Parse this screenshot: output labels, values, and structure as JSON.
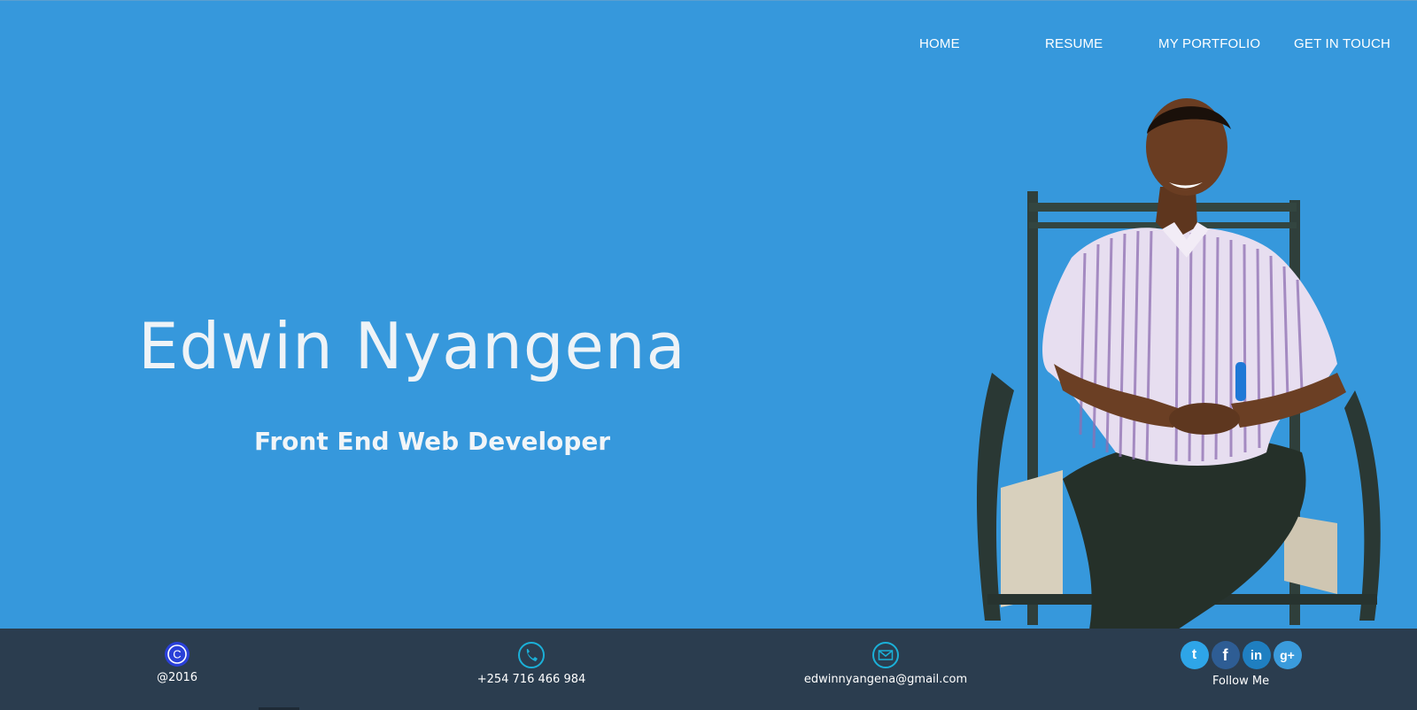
{
  "nav": {
    "items": [
      {
        "label": "HOME"
      },
      {
        "label": "RESUME"
      },
      {
        "label": "MY PORTFOLIO"
      },
      {
        "label": "GET IN TOUCH"
      }
    ]
  },
  "hero": {
    "name": "Edwin Nyangena",
    "role": "Front End Web Developer",
    "background_color": "#3698dc"
  },
  "footer": {
    "copyright": "@2016",
    "phone": "+254 716 466 984",
    "email": "edwinnyangena@gmail.com",
    "follow_label": "Follow Me",
    "social": [
      {
        "icon": "twitter-icon",
        "glyph": "t",
        "color": "#2ea5e8"
      },
      {
        "icon": "facebook-icon",
        "glyph": "f",
        "color": "#2e5d94"
      },
      {
        "icon": "linkedin-icon",
        "glyph": "in",
        "color": "#1f7fc1"
      },
      {
        "icon": "google-plus-icon",
        "glyph": "g+",
        "color": "#3a9bdc"
      }
    ],
    "background_color": "#2b3d4f",
    "accent_color": "#1bb0d8"
  }
}
